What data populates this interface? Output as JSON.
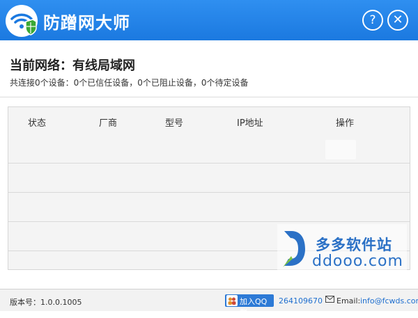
{
  "app": {
    "title": "防蹭网大师"
  },
  "titlebar": {
    "help_label": "?",
    "close_label": "✕"
  },
  "network": {
    "title": "当前网络：有线局域网",
    "stats": "共连接0个设备：0个已信任设备，0个已阻止设备，0个待定设备"
  },
  "table": {
    "columns": [
      "状态",
      "厂商",
      "型号",
      "IP地址",
      "操作"
    ],
    "rows": []
  },
  "watermark": {
    "cn": "多多软件站",
    "en": "ddooo.com"
  },
  "statusbar": {
    "version": "版本号：1.0.0.1005",
    "qq_label": "加入QQ群",
    "qq_number": "264109670",
    "email_label": "Email:",
    "email": "info@fcwds.com"
  },
  "colors": {
    "titlebar": "#2388ec",
    "accent": "#1f6fcf",
    "shield": "#3aa835"
  }
}
